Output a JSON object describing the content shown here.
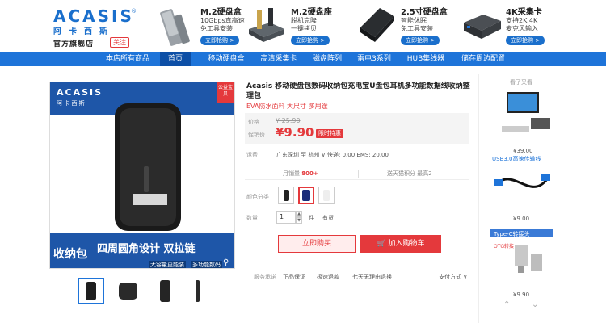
{
  "header": {
    "logo_text": "ACASIS",
    "logo_reg": "®",
    "logo_cn": "阿卡西斯",
    "shop_name": "官方旗舰店",
    "follow_label": "关注",
    "promos": [
      {
        "title": "M.2硬盘盒",
        "line1": "10Gbps真高速",
        "line2": "免工具安装",
        "button": "立即抢购 >"
      },
      {
        "title": "M.2硬盘座",
        "line1": "脱机克隆",
        "line2": "一键拷贝",
        "button": "立即抢购 >"
      },
      {
        "title": "2.5寸硬盘盒",
        "line1": "智能休眠",
        "line2": "免工具安装",
        "button": "立即抢购 >"
      },
      {
        "title": "4K采集卡",
        "line1": "支持2K 4K",
        "line2": "麦克风输入",
        "button": "立即抢购 >"
      }
    ]
  },
  "nav": {
    "items": [
      "本店所有商品",
      "首页",
      "移动硬盘盒",
      "高清采集卡",
      "磁盘阵列",
      "雷电3系列",
      "HUB集线器",
      "储存周边配置"
    ],
    "active_index": 1
  },
  "gallery": {
    "badge": "公益宝贝",
    "case_brand": "ACASIS",
    "case_brand_cn": "阿 卡 西 斯",
    "banner_main": "收纳包",
    "banner_sub": "四周圆角设计 双拉链",
    "banner_small1": "大容量更能装",
    "banner_small2": "多功能数码",
    "zoom_icon": "magnifier-icon",
    "thumb_count": 4,
    "selected_thumb": 0
  },
  "product": {
    "title": "Acasis 移动硬盘包数码收纳包充电宝U盘包耳机多功能数据线收纳整理包",
    "subtitle": "EVA防水面料 大尺寸 多用途",
    "price_label": "价格",
    "old_price": "¥ 25.90",
    "promo_label": "促销价",
    "price": "¥9.90",
    "promo_tag": "限时特惠",
    "shipping_label": "运费",
    "shipping_text": "广东深圳 至 杭州 ∨ 快递: 0.00 EMS: 20.00",
    "monthly_sales_label": "月销量",
    "monthly_sales": "800+",
    "points_text": "送天猫积分",
    "points_value": "最高2",
    "color_label": "颜色分类",
    "qty_label": "数量",
    "qty_value": "1",
    "qty_unit": "件",
    "stock_text": "有货",
    "buy_now": "立即购买",
    "add_cart": "加入购物车",
    "guarantee_label": "服务承诺",
    "guarantees": [
      "正品保证",
      "极速退款",
      "七天无理由退换"
    ],
    "payment_label": "支付方式 ∨"
  },
  "sidebar": {
    "title": "看了又看",
    "items": [
      {
        "price": "¥39.00"
      },
      {
        "price": "¥9.00",
        "label": "USB3.0高速传输线"
      },
      {
        "price": "¥9.90",
        "label": "Type-C转接头",
        "label2": "OTG转接"
      }
    ]
  },
  "colors": {
    "accent": "#e4393c",
    "brand": "#1e74d9"
  }
}
